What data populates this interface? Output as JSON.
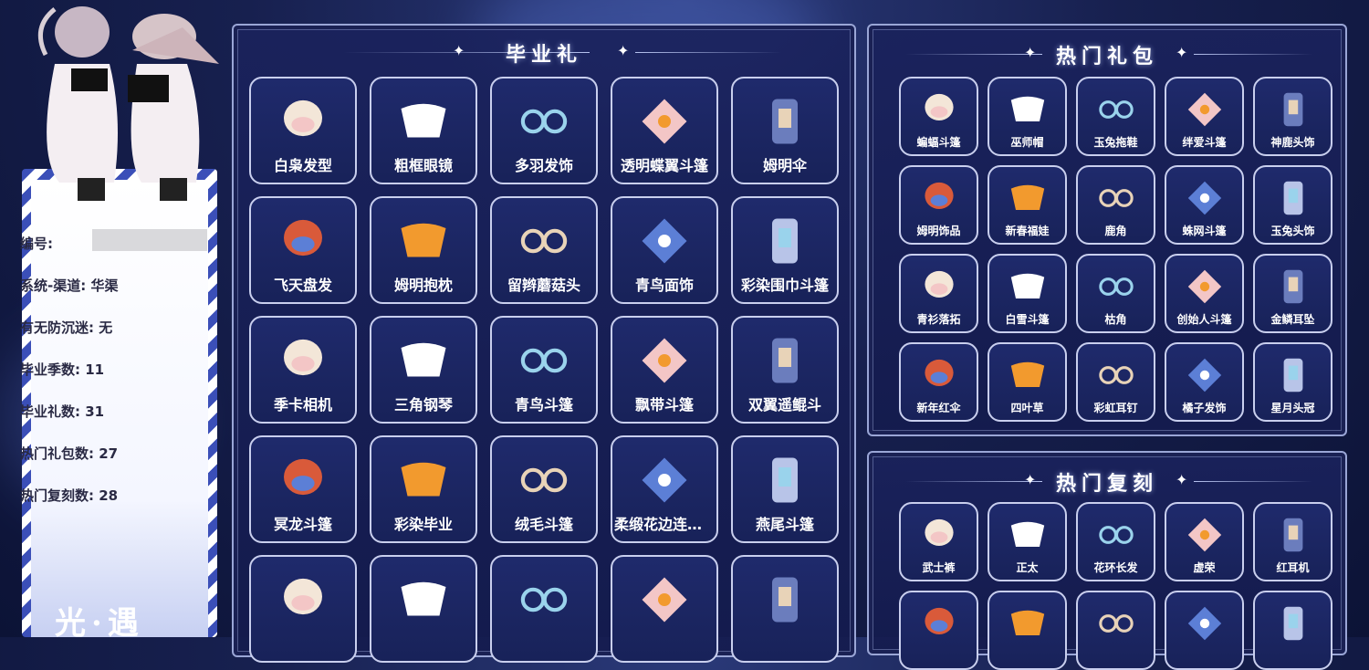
{
  "info": {
    "id_label": "编号:",
    "channel_label": "系统-渠道:",
    "channel_value": "华渠",
    "anti_addiction_label": "有无防沉迷:",
    "anti_addiction_value": "无",
    "seasons_label": "毕业季数:",
    "seasons_value": "11",
    "grad_gifts_label": "毕业礼数:",
    "grad_gifts_value": "31",
    "hot_packs_label": "热门礼包数:",
    "hot_packs_value": "27",
    "hot_reprints_label": "热门复刻数:",
    "hot_reprints_value": "28"
  },
  "signature": "光·遇",
  "graduation": {
    "title": "毕业礼",
    "items": [
      {
        "label": "白枭发型",
        "icon": "hair-icon"
      },
      {
        "label": "粗框眼镜",
        "icon": "glasses-icon"
      },
      {
        "label": "多羽发饰",
        "icon": "feather-headband-icon"
      },
      {
        "label": "透明蝶翼斗篷",
        "icon": "butterfly-cape-icon"
      },
      {
        "label": "姆明伞",
        "icon": "umbrella-icon"
      },
      {
        "label": "飞天盘发",
        "icon": "hair-bun-icon"
      },
      {
        "label": "姆明抱枕",
        "icon": "moomin-pillow-icon"
      },
      {
        "label": "留辫蘑菇头",
        "icon": "mushroom-hair-icon"
      },
      {
        "label": "青鸟面饰",
        "icon": "bird-mask-icon"
      },
      {
        "label": "彩染围巾斗篷",
        "icon": "scarf-cape-icon"
      },
      {
        "label": "季卡相机",
        "icon": "camera-icon"
      },
      {
        "label": "三角钢琴",
        "icon": "piano-icon"
      },
      {
        "label": "青鸟斗篷",
        "icon": "bird-cape-icon"
      },
      {
        "label": "飘带斗篷",
        "icon": "ribbon-cape-icon"
      },
      {
        "label": "双翼遥鲲斗",
        "icon": "wing-cape-icon"
      },
      {
        "label": "冥龙斗篷",
        "icon": "dragon-cape-icon"
      },
      {
        "label": "彩染毕业",
        "icon": "mask-icon"
      },
      {
        "label": "绒毛斗篷",
        "icon": "fluffy-cape-icon"
      },
      {
        "label": "柔缎花边连体…",
        "icon": "dress-icon"
      },
      {
        "label": "燕尾斗篷",
        "icon": "swallow-cape-icon"
      },
      {
        "label": "",
        "icon": "red-cape-icon"
      },
      {
        "label": "",
        "icon": "outfit-icon"
      },
      {
        "label": "",
        "icon": "blue-cape-icon"
      },
      {
        "label": "",
        "icon": "white-dress-icon"
      },
      {
        "label": "",
        "icon": "card-icon"
      }
    ]
  },
  "hot_packs": {
    "title": "热门礼包",
    "items": [
      {
        "label": "蝙蝠斗篷",
        "icon": "bat-cape-icon"
      },
      {
        "label": "巫师帽",
        "icon": "witch-hat-icon"
      },
      {
        "label": "玉兔拖鞋",
        "icon": "rabbit-slipper-icon"
      },
      {
        "label": "绊爱斗篷",
        "icon": "heart-cape-icon"
      },
      {
        "label": "神鹿头饰",
        "icon": "deer-headpiece-icon"
      },
      {
        "label": "姆明饰品",
        "icon": "moomin-charm-icon"
      },
      {
        "label": "新春福娃",
        "icon": "spring-cape-icon"
      },
      {
        "label": "鹿角",
        "icon": "antler-icon"
      },
      {
        "label": "蛛网斗篷",
        "icon": "web-cape-icon"
      },
      {
        "label": "玉兔头饰",
        "icon": "rabbit-headpiece-icon"
      },
      {
        "label": "青衫落拓",
        "icon": "robe-icon"
      },
      {
        "label": "白雪斗篷",
        "icon": "snow-cape-icon"
      },
      {
        "label": "枯角",
        "icon": "dry-horn-icon"
      },
      {
        "label": "创始人斗篷",
        "icon": "founder-cape-icon"
      },
      {
        "label": "金鳞耳坠",
        "icon": "earring-icon"
      },
      {
        "label": "新年红伞",
        "icon": "new-year-umbrella-icon"
      },
      {
        "label": "四叶草",
        "icon": "clover-icon"
      },
      {
        "label": "彩虹耳钉",
        "icon": "rainbow-earring-icon"
      },
      {
        "label": "橘子发饰",
        "icon": "orange-hairpin-icon"
      },
      {
        "label": "星月头冠",
        "icon": "star-moon-crown-icon"
      }
    ]
  },
  "hot_reprints": {
    "title": "热门复刻",
    "items": [
      {
        "label": "武士裤",
        "icon": "samurai-pants-icon"
      },
      {
        "label": "正太",
        "icon": "short-hair-icon"
      },
      {
        "label": "花环长发",
        "icon": "wreath-hair-icon"
      },
      {
        "label": "虚荣",
        "icon": "vanity-hair-icon"
      },
      {
        "label": "红耳机",
        "icon": "headphones-icon"
      },
      {
        "label": "",
        "icon": "hat-icon"
      },
      {
        "label": "",
        "icon": "lantern-hat-icon"
      },
      {
        "label": "",
        "icon": "cape-icon"
      },
      {
        "label": "",
        "icon": "robe2-icon"
      },
      {
        "label": "",
        "icon": "cape2-icon"
      }
    ]
  },
  "colors": {
    "panel_bg": "#1a225c",
    "tile_border": "#c9cfee",
    "accent_blue": "#3b4fb8"
  }
}
